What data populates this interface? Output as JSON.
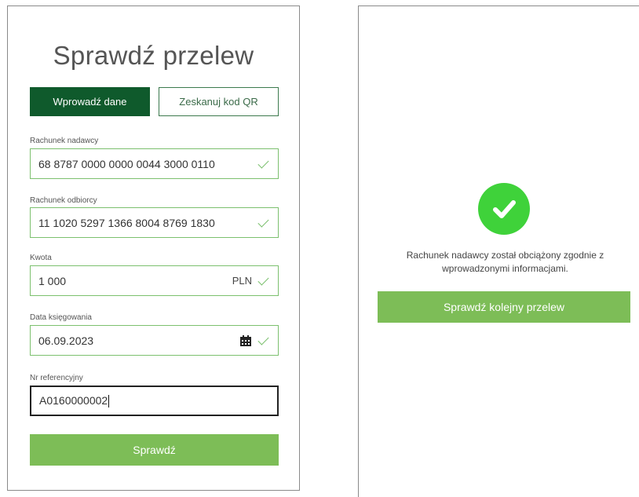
{
  "form": {
    "title": "Sprawdź przelew",
    "tabs": {
      "enter_data": "Wprowadź dane",
      "scan_qr": "Zeskanuj kod QR"
    },
    "fields": {
      "sender_account": {
        "label": "Rachunek nadawcy",
        "value": "68 8787 0000 0000 0044 3000 0110"
      },
      "recipient_account": {
        "label": "Rachunek odbiorcy",
        "value": "11 1020 5297 1366 8004 8769 1830"
      },
      "amount": {
        "label": "Kwota",
        "value": "1 000",
        "currency": "PLN"
      },
      "posting_date": {
        "label": "Data księgowania",
        "value": "06.09.2023"
      },
      "reference": {
        "label": "Nr referencyjny",
        "value": "A0160000002"
      }
    },
    "submit_label": "Sprawdź"
  },
  "result": {
    "message_line1": "Rachunek nadawcy został obciążony zgodnie z",
    "message_line2": "wprowadzonymi informacjami.",
    "next_button_label": "Sprawdź kolejny przelew"
  },
  "colors": {
    "dark_green": "#0f5a2c",
    "light_green": "#7dbd57",
    "success_green": "#3fd23a",
    "field_border": "#7cc06e"
  }
}
